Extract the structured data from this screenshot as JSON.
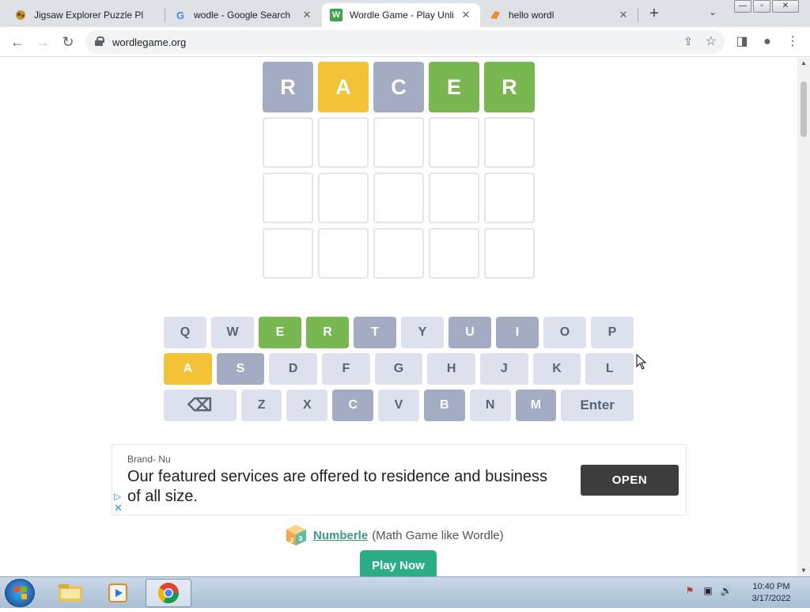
{
  "browser": {
    "tabs": [
      {
        "title": "Jigsaw Explorer Puzzle Pl",
        "icon": "puzzle-icon",
        "active": false
      },
      {
        "title": "wodle - Google Search",
        "icon": "google-icon",
        "active": false
      },
      {
        "title": "Wordle Game - Play Unli",
        "icon": "wordle-icon",
        "active": true
      },
      {
        "title": "hello wordl",
        "icon": "hello-wordl-icon",
        "active": false
      }
    ],
    "favicon_letters": {
      "google": "G",
      "wordle": "W"
    },
    "close_glyph": "✕",
    "new_tab": "+",
    "tab_list": "⌄",
    "window_buttons": {
      "minimize": "—",
      "maximize": "▫",
      "close": "✕"
    },
    "nav": {
      "back": "←",
      "forward": "→",
      "reload": "↻"
    },
    "url": "wordlegame.org",
    "share_glyph": "⇪",
    "bookmark_glyph": "☆",
    "side_panel_glyph": "◨",
    "profile_glyph": "●",
    "menu_glyph": "⋮"
  },
  "board": {
    "partial_row": [
      {
        "letter": "",
        "state": "absent"
      },
      {
        "letter": "",
        "state": "absent"
      },
      {
        "letter": "",
        "state": "absent"
      },
      {
        "letter": "",
        "state": "present"
      },
      {
        "letter": "",
        "state": "present"
      }
    ],
    "rows": [
      [
        {
          "letter": "R",
          "state": "absent"
        },
        {
          "letter": "A",
          "state": "present"
        },
        {
          "letter": "C",
          "state": "absent"
        },
        {
          "letter": "E",
          "state": "correct"
        },
        {
          "letter": "R",
          "state": "correct"
        }
      ],
      [
        {
          "letter": "",
          "state": "empty"
        },
        {
          "letter": "",
          "state": "empty"
        },
        {
          "letter": "",
          "state": "empty"
        },
        {
          "letter": "",
          "state": "empty"
        },
        {
          "letter": "",
          "state": "empty"
        }
      ],
      [
        {
          "letter": "",
          "state": "empty"
        },
        {
          "letter": "",
          "state": "empty"
        },
        {
          "letter": "",
          "state": "empty"
        },
        {
          "letter": "",
          "state": "empty"
        },
        {
          "letter": "",
          "state": "empty"
        }
      ],
      [
        {
          "letter": "",
          "state": "empty"
        },
        {
          "letter": "",
          "state": "empty"
        },
        {
          "letter": "",
          "state": "empty"
        },
        {
          "letter": "",
          "state": "empty"
        },
        {
          "letter": "",
          "state": "empty"
        }
      ]
    ]
  },
  "keyboard": {
    "rows": [
      [
        {
          "label": "Q",
          "state": "unused"
        },
        {
          "label": "W",
          "state": "unused"
        },
        {
          "label": "E",
          "state": "correct"
        },
        {
          "label": "R",
          "state": "correct"
        },
        {
          "label": "T",
          "state": "absent"
        },
        {
          "label": "Y",
          "state": "unused"
        },
        {
          "label": "U",
          "state": "absent"
        },
        {
          "label": "I",
          "state": "absent"
        },
        {
          "label": "O",
          "state": "unused"
        },
        {
          "label": "P",
          "state": "unused"
        }
      ],
      [
        {
          "label": "A",
          "state": "present"
        },
        {
          "label": "S",
          "state": "absent"
        },
        {
          "label": "D",
          "state": "unused"
        },
        {
          "label": "F",
          "state": "unused"
        },
        {
          "label": "G",
          "state": "unused"
        },
        {
          "label": "H",
          "state": "unused"
        },
        {
          "label": "J",
          "state": "unused"
        },
        {
          "label": "K",
          "state": "unused"
        },
        {
          "label": "L",
          "state": "unused"
        }
      ],
      [
        {
          "label": "⌫",
          "state": "unused",
          "kind": "backspace"
        },
        {
          "label": "Z",
          "state": "unused"
        },
        {
          "label": "X",
          "state": "unused"
        },
        {
          "label": "C",
          "state": "absent"
        },
        {
          "label": "V",
          "state": "unused"
        },
        {
          "label": "B",
          "state": "absent"
        },
        {
          "label": "N",
          "state": "unused"
        },
        {
          "label": "M",
          "state": "absent"
        },
        {
          "label": "Enter",
          "state": "unused",
          "kind": "enter"
        }
      ]
    ]
  },
  "ad": {
    "brand": "Brand- Nu",
    "headline": "Our featured services are offered to residence and business of all size.",
    "cta": "OPEN",
    "adchoice_glyph": "▷",
    "close_glyph": "✕"
  },
  "promo": {
    "link_text": "Numberle",
    "description": "(Math Game like Wordle)",
    "button": "Play Now"
  },
  "scrollbar": {
    "up": "▲",
    "down": "▼"
  },
  "taskbar": {
    "apps": [
      "file-explorer-icon",
      "media-player-icon",
      "chrome-icon"
    ],
    "tray_glyphs": {
      "flag": "⚑",
      "network": "▣",
      "volume": "🔊"
    },
    "time": "10:40 PM",
    "date": "3/17/2022"
  },
  "colors": {
    "absent": "#a3acc3",
    "present": "#f3c237",
    "correct": "#79b851",
    "play_now": "#2bae86"
  }
}
